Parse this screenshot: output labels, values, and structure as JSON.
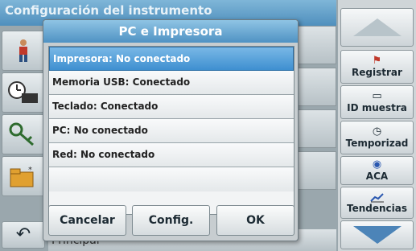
{
  "background": {
    "title": "Configuración del instrumento",
    "bottom_label": "Principal"
  },
  "dialog": {
    "title": "PC e Impresora",
    "items": [
      {
        "label": "Impresora: No conectado",
        "selected": true
      },
      {
        "label": "Memoria USB: Conectado",
        "selected": false
      },
      {
        "label": "Teclado: Conectado",
        "selected": false
      },
      {
        "label": "PC: No conectado",
        "selected": false
      },
      {
        "label": "Red: No conectado",
        "selected": false
      },
      {
        "label": "",
        "selected": false
      }
    ],
    "buttons": {
      "cancel": "Cancelar",
      "config": "Config.",
      "ok": "OK"
    }
  },
  "sidebar": {
    "registrar": "Registrar",
    "id_muestra": "ID muestra",
    "temporizador": "Temporizad",
    "aca": "ACA",
    "tendencias": "Tendencias"
  },
  "colors": {
    "title_bar": "#4f92c3",
    "selection": "#3e8fd0"
  }
}
